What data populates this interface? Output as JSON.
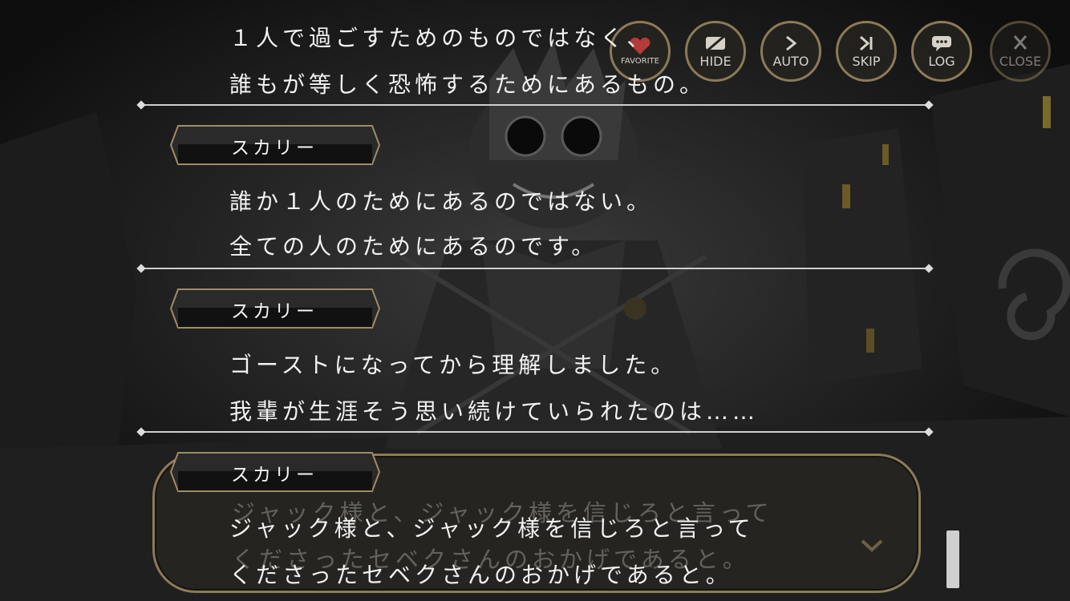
{
  "controls": {
    "favorite": "FAVORITE",
    "hide": "HIDE",
    "auto": "AUTO",
    "skip": "SKIP",
    "log": "LOG",
    "close": "CLOSE"
  },
  "log": {
    "entries": [
      {
        "speaker": "",
        "lines": [
          "１人で過ごすためのものではなく、",
          "誰もが等しく恐怖するためにあるもの。"
        ]
      },
      {
        "speaker": "スカリー",
        "lines": [
          "誰か１人のためにあるのではない。",
          "全ての人のためにあるのです。"
        ]
      },
      {
        "speaker": "スカリー",
        "lines": [
          "ゴーストになってから理解しました。",
          "我輩が生涯そう思い続けていられたのは……"
        ]
      },
      {
        "speaker": "スカリー",
        "lines": [
          "ジャック様と、ジャック様を信じろと言って",
          "くださったセベクさんのおかげであると。"
        ]
      }
    ]
  },
  "dialog": {
    "lines": [
      "ジャック様と、ジャック様を信じろと言って",
      "くださったセベクさんのおかげであると。"
    ]
  },
  "colors": {
    "accent_gold": "#8c7a58",
    "text": "#f2f2f2",
    "background": "#151515"
  }
}
